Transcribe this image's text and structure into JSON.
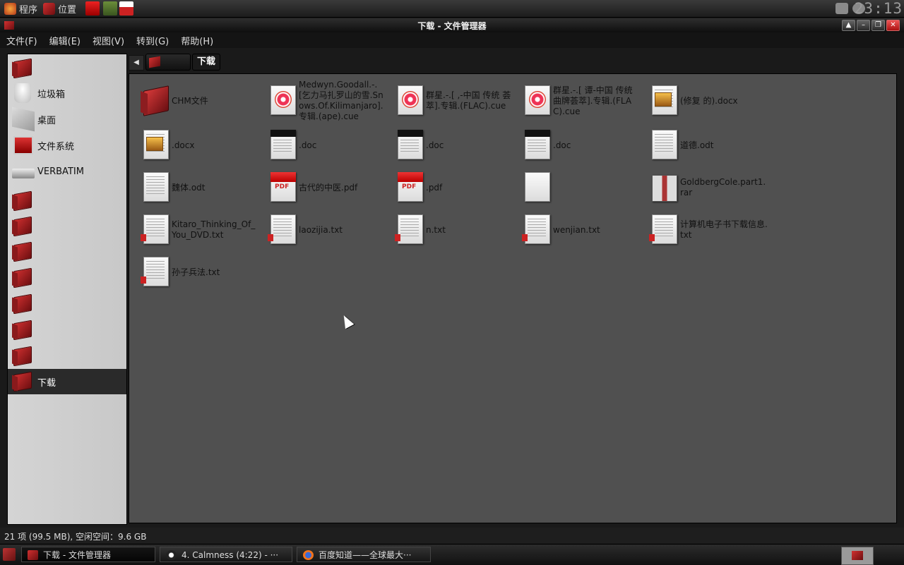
{
  "top_panel": {
    "apps_menu": "程序",
    "places_menu": "位置",
    "clock": "23:13"
  },
  "window": {
    "title": "下载 - 文件管理器"
  },
  "menubar": [
    {
      "label": "文件(F)"
    },
    {
      "label": "编辑(E)"
    },
    {
      "label": "视图(V)"
    },
    {
      "label": "转到(G)"
    },
    {
      "label": "帮助(H)"
    }
  ],
  "sidebar": {
    "items": [
      {
        "label": "",
        "icon": "folder-icon"
      },
      {
        "label": "垃圾箱",
        "icon": "trash-icon"
      },
      {
        "label": "桌面",
        "icon": "desktop-icon"
      },
      {
        "label": "文件系统",
        "icon": "filesystem-icon"
      },
      {
        "label": "VERBATIM",
        "icon": "usb-drive-icon"
      },
      {
        "label": "",
        "icon": "folder-icon"
      },
      {
        "label": "",
        "icon": "folder-icon"
      },
      {
        "label": "",
        "icon": "folder-icon"
      },
      {
        "label": "",
        "icon": "folder-icon"
      },
      {
        "label": "",
        "icon": "folder-icon"
      },
      {
        "label": "",
        "icon": "folder-icon"
      },
      {
        "label": "",
        "icon": "folder-icon"
      },
      {
        "label": "下载",
        "icon": "folder-icon",
        "selected": true
      }
    ]
  },
  "location": {
    "current": "下载"
  },
  "files": [
    {
      "name": "CHM文件",
      "type": "folder"
    },
    {
      "name": "Medwyn.Goodall.-.[乞力马扎罗山的雪.Snows.Of.Kilimanjaro].专辑.(ape).cue",
      "type": "cue"
    },
    {
      "name": "群星.-.[ ,-中国 传统 荟萃].专辑.(FLAC).cue",
      "type": "cue"
    },
    {
      "name": "群星.-.[ 谭-中国 传统曲牌荟萃].专辑.(FLAC).cue",
      "type": "cue"
    },
    {
      "name": "(修复 的).docx",
      "type": "docx"
    },
    {
      "name": ".docx",
      "type": "docx"
    },
    {
      "name": ".doc",
      "type": "doc"
    },
    {
      "name": ".doc",
      "type": "doc"
    },
    {
      "name": ".doc",
      "type": "doc"
    },
    {
      "name": "道德.odt",
      "type": "odt"
    },
    {
      "name": "魏体.odt",
      "type": "odt"
    },
    {
      "name": "古代的中医.pdf",
      "type": "pdf"
    },
    {
      "name": ".pdf",
      "type": "pdf"
    },
    {
      "name": "",
      "type": "blank"
    },
    {
      "name": "GoldbergCole.part1.rar",
      "type": "rar"
    },
    {
      "name": "Kitaro_Thinking_Of_You_DVD.txt",
      "type": "txt"
    },
    {
      "name": "laozijia.txt",
      "type": "txt"
    },
    {
      "name": "n.txt",
      "type": "txt"
    },
    {
      "name": "wenjian.txt",
      "type": "txt"
    },
    {
      "name": "计算机电子书下载信息.txt",
      "type": "txt"
    },
    {
      "name": "孙子兵法.txt",
      "type": "txt"
    }
  ],
  "status": "21 项 (99.5 MB), 空闲空间：9.6 GB",
  "taskbar": [
    {
      "label": "下载 - 文件管理器",
      "icon": "folder-icon",
      "active": true
    },
    {
      "label": "4. Calmness (4:22) - ···",
      "icon": "music-player-icon"
    },
    {
      "label": "百度知道——全球最大···",
      "icon": "firefox-icon"
    }
  ]
}
